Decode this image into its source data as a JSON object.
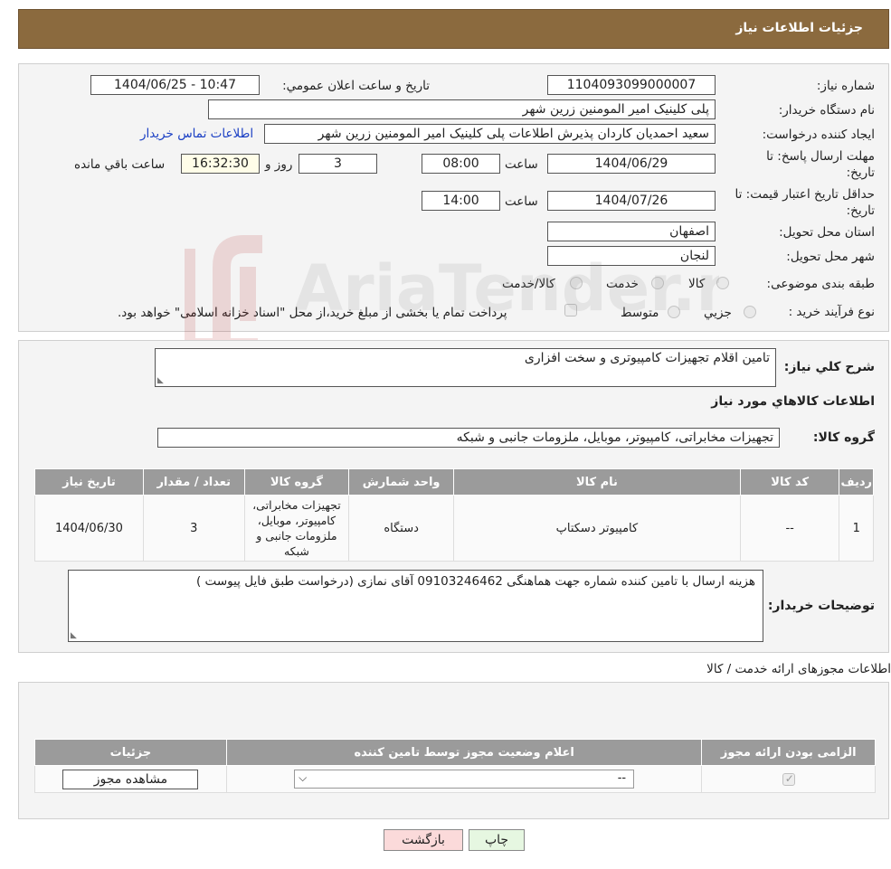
{
  "header": {
    "title": "جزئیات اطلاعات نیاز"
  },
  "form": {
    "need_number": {
      "label": "شماره نیاز:",
      "value": "1104093099000007"
    },
    "announce_datetime": {
      "label": "تاریخ و ساعت اعلان عمومي:",
      "value": "1404/06/25 - 10:47"
    },
    "buyer_org": {
      "label": "نام دستگاه خريدار:",
      "value": "پلی کلینیک امیر المومنین زرین شهر"
    },
    "requester": {
      "label": "ايجاد کننده درخواست:",
      "value": "سعید احمدیان کاردان پذیرش اطلاعات پلی کلینیک امیر المومنین زرین شهر",
      "contact_link": "اطلاعات تماس خريدار"
    },
    "reply_deadline": {
      "label": "مهلت ارسال پاسخ: تا تاريخ:",
      "date": "1404/06/29",
      "time_label": "ساعت",
      "time": "08:00",
      "days": "3",
      "days_label": "روز و",
      "remaining": "16:32:30",
      "remaining_label": "ساعت باقي مانده"
    },
    "price_validity": {
      "label": "حداقل تاريخ اعتبار قيمت: تا تاريخ:",
      "date": "1404/07/26",
      "time_label": "ساعت",
      "time": "14:00"
    },
    "province": {
      "label": "استان محل تحويل:",
      "value": "اصفهان"
    },
    "city": {
      "label": "شهر محل تحويل:",
      "value": "لنجان"
    },
    "category": {
      "label": "طبقه بندی موضوعی:",
      "options": [
        "کالا",
        "خدمت",
        "کالا/خدمت"
      ]
    },
    "process_type": {
      "label": "نوع فرآيند خريد :",
      "options": [
        "جزيي",
        "متوسط"
      ],
      "note": "پرداخت تمام يا بخشی از مبلغ خريد،از محل \"اسناد خزانه اسلامی\" خواهد بود."
    }
  },
  "description": {
    "label": "شرح کلي نياز:",
    "value": "تامین اقلام تجهیزات کامپیوتری و سخت افزاری"
  },
  "goods_section": {
    "title": "اطلاعات کالاهاي مورد نياز",
    "group_label": "گروه کالا:",
    "group_value": "تجهیزات مخابراتی، کامپیوتر، موبایل، ملزومات جانبی و شبکه",
    "columns": [
      "رديف",
      "کد کالا",
      "نام کالا",
      "واحد شمارش",
      "گروه کالا",
      "تعداد / مقدار",
      "تاريخ نياز"
    ],
    "rows": [
      {
        "index": "1",
        "code": "--",
        "name": "کامپیوتر دسکتاپ",
        "unit": "دستگاه",
        "group": "تجهیزات مخابراتی، کامپیوتر، موبایل، ملزومات جانبی و شبکه",
        "qty": "3",
        "date": "1404/06/30"
      }
    ]
  },
  "buyer_notes": {
    "label": "توضيحات خريدار:",
    "value": "هزینه ارسال با تامین کننده شماره جهت هماهنگی  09103246462 آقای نمازی (درخواست طبق فایل پیوست )"
  },
  "permits": {
    "title": "اطلاعات مجوزهای ارائه خدمت / کالا",
    "columns": [
      "الزامی بودن ارائه مجوز",
      "اعلام وضعیت مجوز توسط تامین کننده",
      "جزئیات"
    ],
    "rows": [
      {
        "required_checked": true,
        "status_selected": "--",
        "details_button": "مشاهده مجوز"
      }
    ]
  },
  "actions": {
    "print": "چاپ",
    "back": "بازگشت"
  },
  "colors": {
    "header": "#8b6a3e",
    "table_header": "#9b9b9b",
    "panel": "#f4f4f4",
    "link": "#1a3fc4",
    "back_button": "#fbdada",
    "print_button": "#e6f7e1"
  },
  "watermark": {
    "text": "AriaTender.neT"
  }
}
